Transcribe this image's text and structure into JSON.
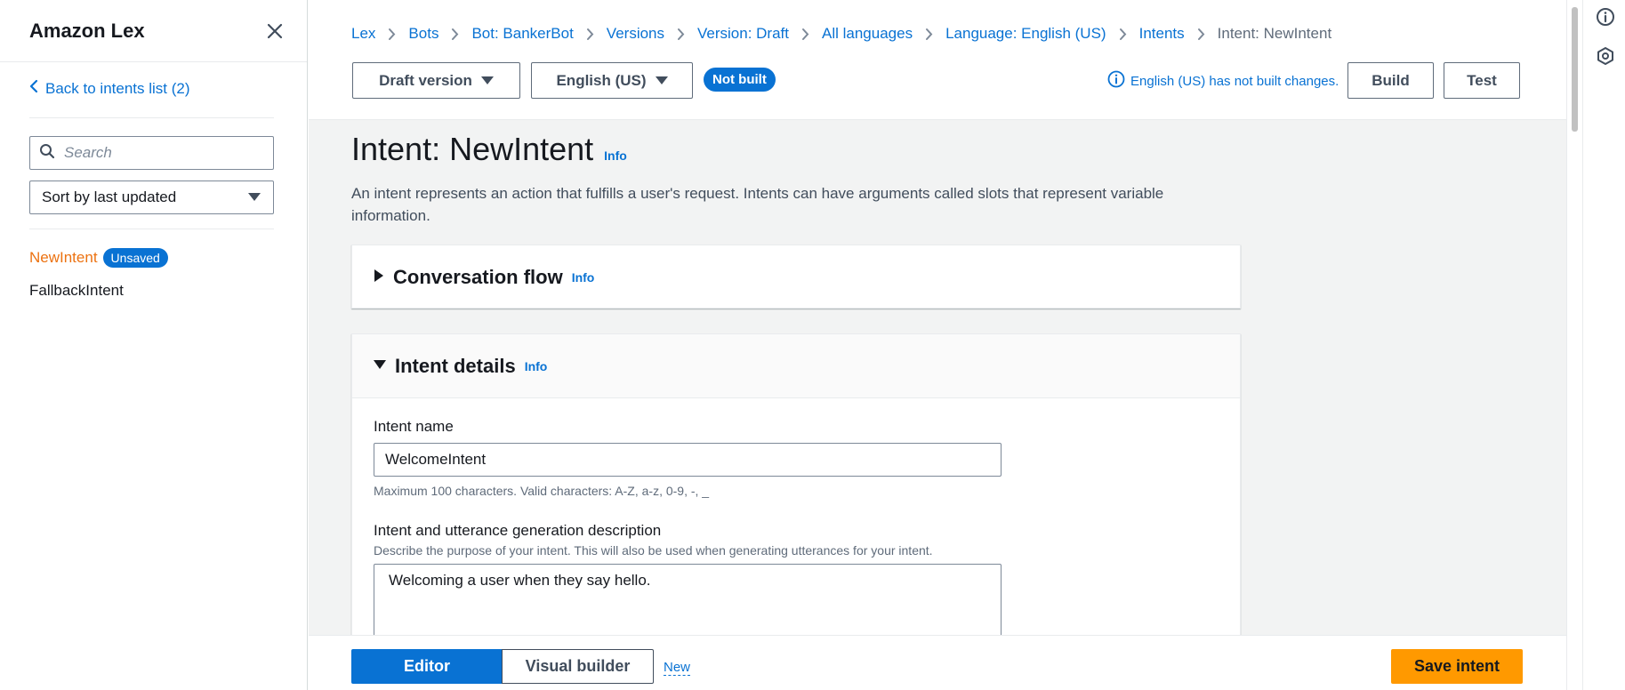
{
  "sidebar": {
    "title": "Amazon Lex",
    "back_link": "Back to intents list (2)",
    "search_placeholder": "Search",
    "sort_label": "Sort by last updated",
    "intents": [
      {
        "name": "NewIntent",
        "badge": "Unsaved",
        "active": true
      },
      {
        "name": "FallbackIntent",
        "badge": "",
        "active": false
      }
    ]
  },
  "breadcrumb": {
    "items": [
      "Lex",
      "Bots",
      "Bot: BankerBot",
      "Versions",
      "Version: Draft",
      "All languages",
      "Language: English (US)",
      "Intents"
    ],
    "current": "Intent: NewIntent"
  },
  "toolbar": {
    "version_select": "Draft version",
    "language_select": "English (US)",
    "status_badge": "Not built",
    "status_note": "English (US) has not built changes.",
    "build_label": "Build",
    "test_label": "Test"
  },
  "page": {
    "title": "Intent: NewIntent",
    "info_label": "Info",
    "description": "An intent represents an action that fulfills a user's request. Intents can have arguments called slots that represent variable information."
  },
  "conversation_flow": {
    "heading": "Conversation flow",
    "info_label": "Info",
    "expanded": false
  },
  "intent_details": {
    "heading": "Intent details",
    "info_label": "Info",
    "expanded": true,
    "name_label": "Intent name",
    "name_value": "WelcomeIntent",
    "name_hint": "Maximum 100 characters. Valid characters: A-Z, a-z, 0-9, -, _",
    "desc_label": "Intent and utterance generation description",
    "desc_hint": "Describe the purpose of your intent. This will also be used when generating utterances for your intent.",
    "desc_value": "Welcoming a user when they say hello."
  },
  "bottom": {
    "editor_label": "Editor",
    "visual_label": "Visual builder",
    "new_label": "New",
    "save_label": "Save intent"
  },
  "colors": {
    "link": "#0972d3",
    "active_intent": "#ec7211",
    "primary_button": "#ff9900",
    "content_bg": "#f2f3f3"
  }
}
